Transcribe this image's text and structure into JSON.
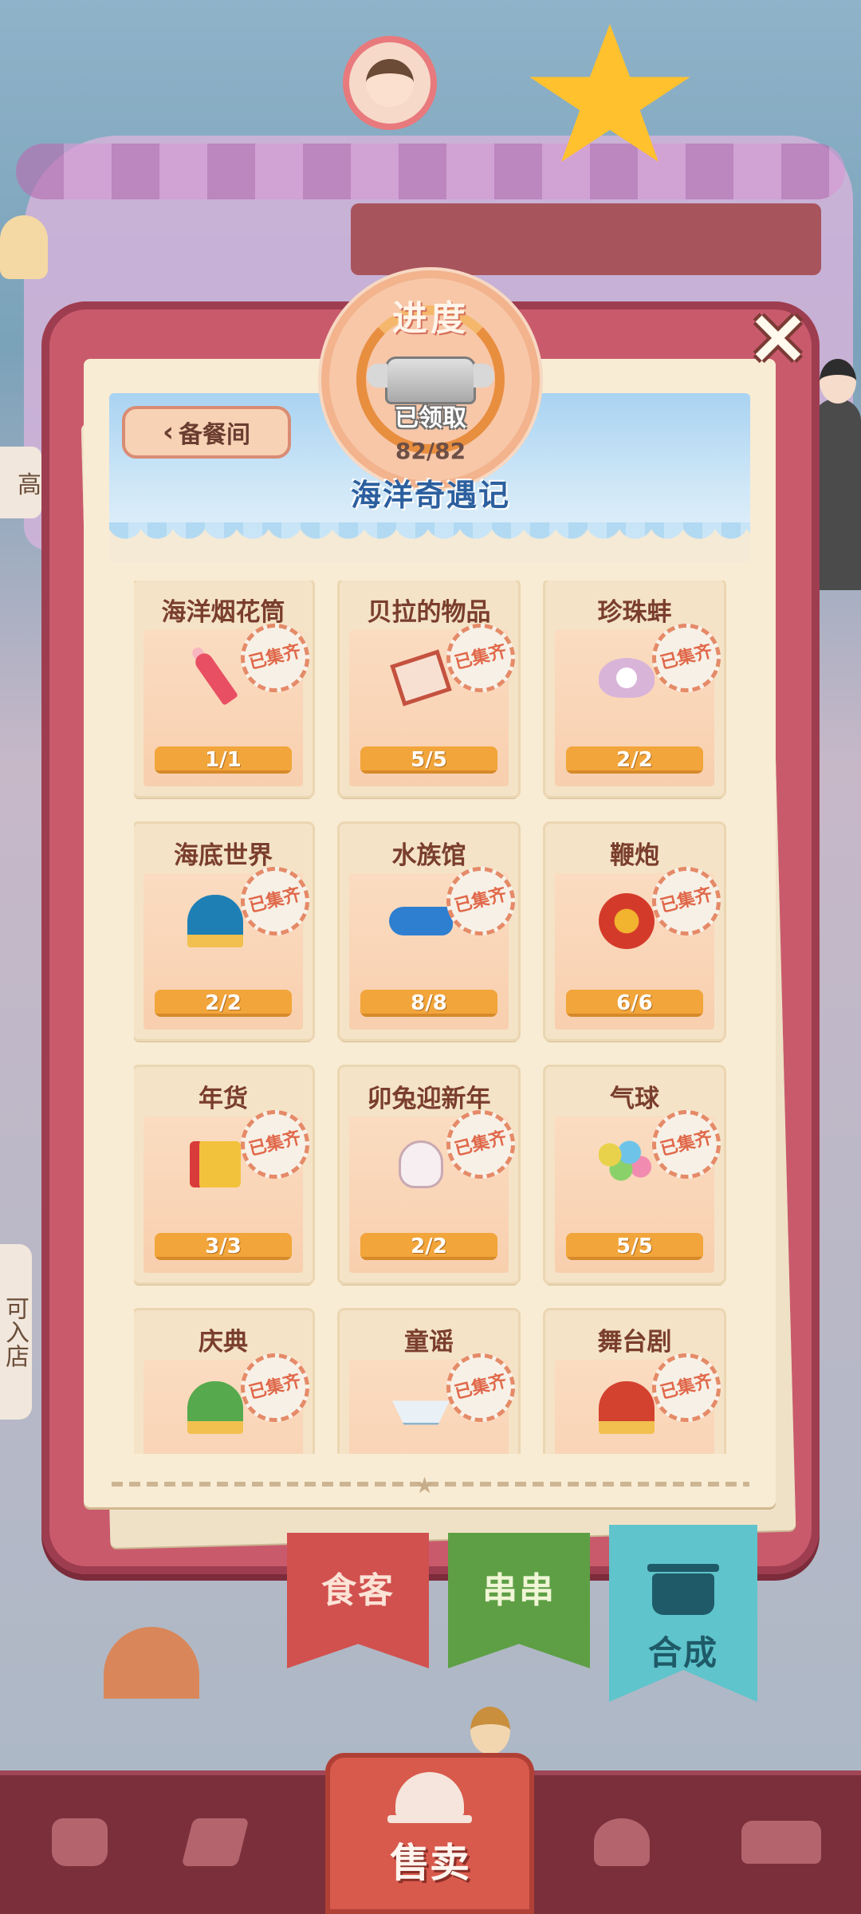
{
  "background": {
    "side_sign_text": "高",
    "side_sign2_text": "可入店"
  },
  "close_icon_glyph": "×",
  "back_button": {
    "label": "备餐间",
    "chevron": "‹"
  },
  "progress": {
    "title": "进度",
    "status": "已领取",
    "current": 82,
    "total": 82,
    "count_text": "82/82"
  },
  "event_title": "海洋奇遇记",
  "stamp_text": "已集齐",
  "collections": [
    {
      "name": "海洋烟花筒",
      "progress_text": "1/1",
      "icon": "firework-rocket-icon",
      "shape": "ico-rocket",
      "current": 1,
      "total": 1
    },
    {
      "name": "贝拉的物品",
      "progress_text": "5/5",
      "icon": "photo-frame-icon",
      "shape": "ico-photo",
      "current": 5,
      "total": 5
    },
    {
      "name": "珍珠蚌",
      "progress_text": "2/2",
      "icon": "pearl-oyster-icon",
      "shape": "ico-pearl",
      "current": 2,
      "total": 2
    },
    {
      "name": "海底世界",
      "progress_text": "2/2",
      "icon": "undersea-stage-icon",
      "shape": "ico-stage-blue",
      "current": 2,
      "total": 2
    },
    {
      "name": "水族馆",
      "progress_text": "8/8",
      "icon": "whale-icon",
      "shape": "ico-whale",
      "current": 8,
      "total": 8
    },
    {
      "name": "鞭炮",
      "progress_text": "6/6",
      "icon": "firecracker-icon",
      "shape": "ico-crackers",
      "current": 6,
      "total": 6
    },
    {
      "name": "年货",
      "progress_text": "3/3",
      "icon": "gift-box-icon",
      "shape": "ico-gift",
      "current": 3,
      "total": 3
    },
    {
      "name": "卯兔迎新年",
      "progress_text": "2/2",
      "icon": "rabbit-icon",
      "shape": "ico-rabbit",
      "current": 2,
      "total": 2
    },
    {
      "name": "气球",
      "progress_text": "5/5",
      "icon": "balloons-icon",
      "shape": "ico-balloons",
      "current": 5,
      "total": 5
    },
    {
      "name": "庆典",
      "progress_text": "",
      "icon": "celebration-stage-icon",
      "shape": "ico-stage-green",
      "current": null,
      "total": null
    },
    {
      "name": "童谣",
      "progress_text": "",
      "icon": "paper-boat-icon",
      "shape": "ico-boat",
      "current": null,
      "total": null
    },
    {
      "name": "舞台剧",
      "progress_text": "",
      "icon": "theater-stage-icon",
      "shape": "ico-stage-red",
      "current": null,
      "total": null
    }
  ],
  "tabs": [
    {
      "label": "食客"
    },
    {
      "label": "串串"
    },
    {
      "label": "合成"
    }
  ],
  "bottom_nav": {
    "sell_label": "售卖"
  }
}
